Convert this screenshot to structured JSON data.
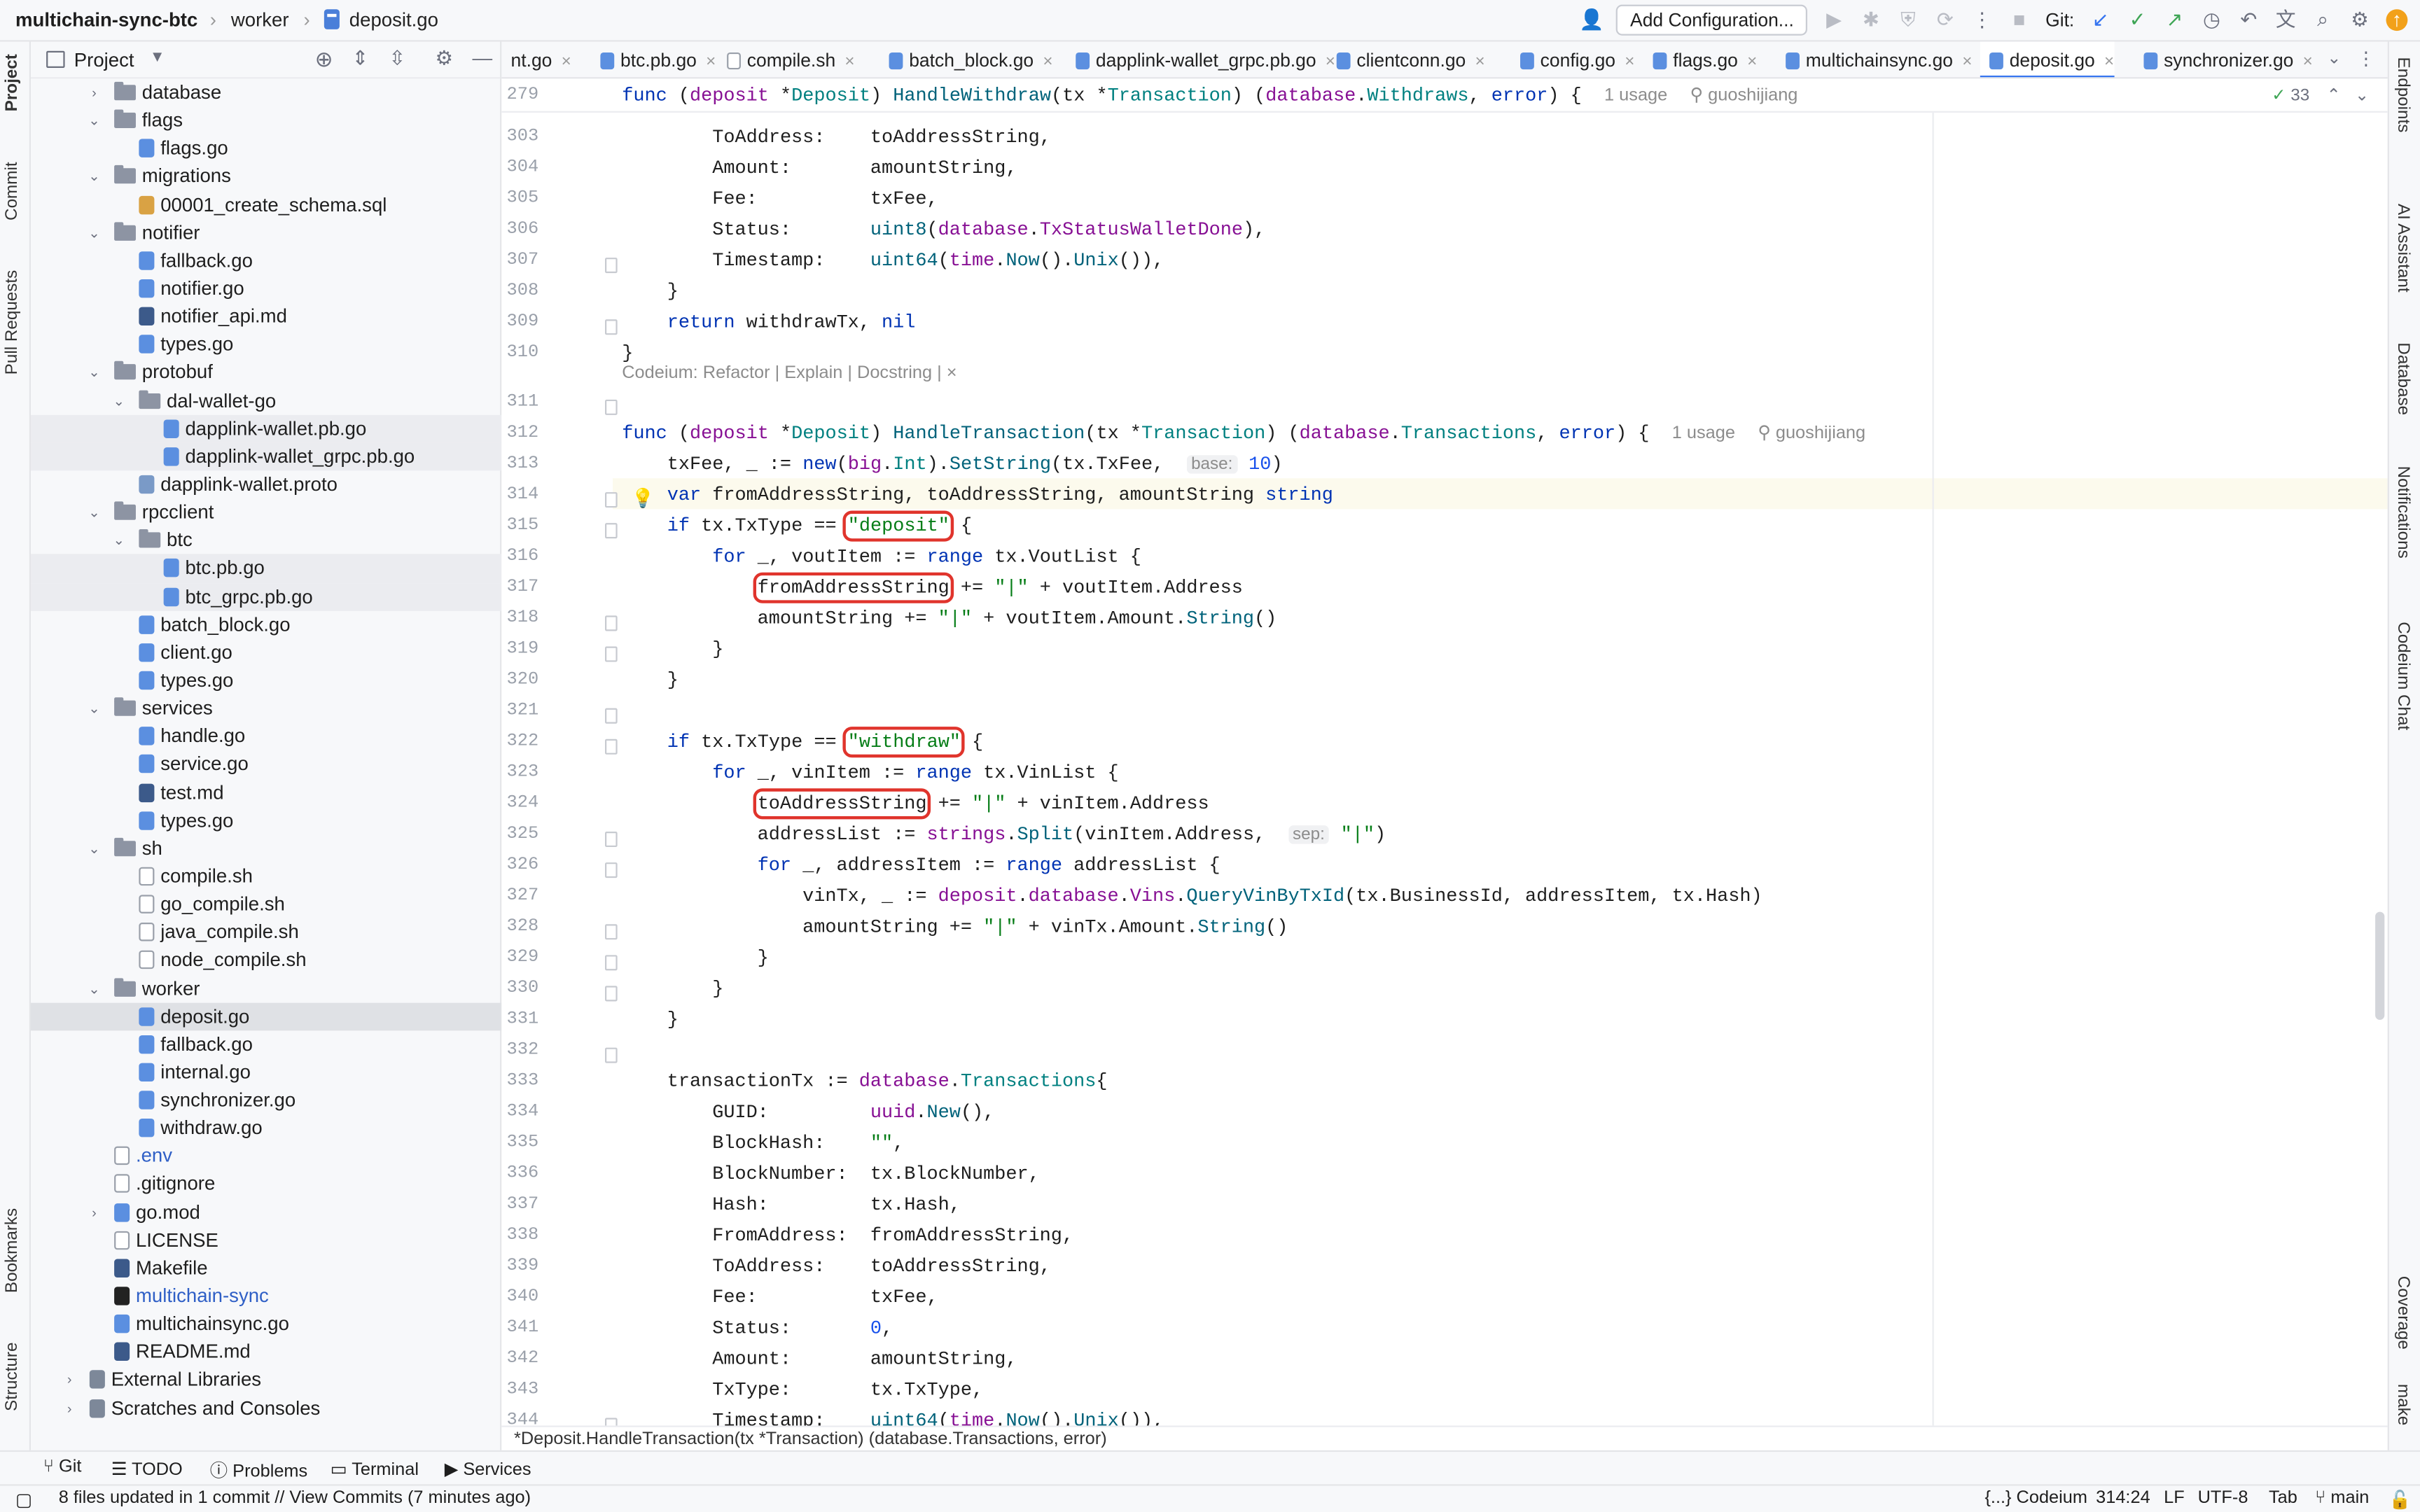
{
  "titlebar": {
    "project": "multichain-sync-btc",
    "breadcrumb": [
      "worker",
      "deposit.go"
    ],
    "add_configuration": "Add Configuration...",
    "git_label": "Git:"
  },
  "project_panel": {
    "title": "Project",
    "tree": [
      {
        "label": "database",
        "type": "folder",
        "depth": 1,
        "arrow": "right"
      },
      {
        "label": "flags",
        "type": "folder",
        "depth": 1,
        "arrow": "down"
      },
      {
        "label": "flags.go",
        "type": "go",
        "depth": 2
      },
      {
        "label": "migrations",
        "type": "folder",
        "depth": 1,
        "arrow": "down"
      },
      {
        "label": "00001_create_schema.sql",
        "type": "sql",
        "depth": 2
      },
      {
        "label": "notifier",
        "type": "folder",
        "depth": 1,
        "arrow": "down"
      },
      {
        "label": "fallback.go",
        "type": "go",
        "depth": 2
      },
      {
        "label": "notifier.go",
        "type": "go",
        "depth": 2
      },
      {
        "label": "notifier_api.md",
        "type": "md",
        "depth": 2
      },
      {
        "label": "types.go",
        "type": "go",
        "depth": 2
      },
      {
        "label": "protobuf",
        "type": "folder",
        "depth": 1,
        "arrow": "down"
      },
      {
        "label": "dal-wallet-go",
        "type": "folder",
        "depth": 2,
        "arrow": "down"
      },
      {
        "label": "dapplink-wallet.pb.go",
        "type": "go",
        "depth": 3,
        "hl": true
      },
      {
        "label": "dapplink-wallet_grpc.pb.go",
        "type": "go",
        "depth": 3,
        "hl": true
      },
      {
        "label": "dapplink-wallet.proto",
        "type": "pb",
        "depth": 2
      },
      {
        "label": "rpcclient",
        "type": "folder",
        "depth": 1,
        "arrow": "down"
      },
      {
        "label": "btc",
        "type": "folder",
        "depth": 2,
        "arrow": "down"
      },
      {
        "label": "btc.pb.go",
        "type": "go",
        "depth": 3,
        "hl": true
      },
      {
        "label": "btc_grpc.pb.go",
        "type": "go",
        "depth": 3,
        "hl": true
      },
      {
        "label": "batch_block.go",
        "type": "go",
        "depth": 2
      },
      {
        "label": "client.go",
        "type": "go",
        "depth": 2
      },
      {
        "label": "types.go",
        "type": "go",
        "depth": 2
      },
      {
        "label": "services",
        "type": "folder",
        "depth": 1,
        "arrow": "down"
      },
      {
        "label": "handle.go",
        "type": "go",
        "depth": 2
      },
      {
        "label": "service.go",
        "type": "go",
        "depth": 2
      },
      {
        "label": "test.md",
        "type": "md",
        "depth": 2
      },
      {
        "label": "types.go",
        "type": "go",
        "depth": 2
      },
      {
        "label": "sh",
        "type": "folder",
        "depth": 1,
        "arrow": "down"
      },
      {
        "label": "compile.sh",
        "type": "sh",
        "depth": 2
      },
      {
        "label": "go_compile.sh",
        "type": "sh",
        "depth": 2
      },
      {
        "label": "java_compile.sh",
        "type": "sh",
        "depth": 2
      },
      {
        "label": "node_compile.sh",
        "type": "sh",
        "depth": 2
      },
      {
        "label": "worker",
        "type": "folder",
        "depth": 1,
        "arrow": "down"
      },
      {
        "label": "deposit.go",
        "type": "go",
        "depth": 2,
        "sel": true
      },
      {
        "label": "fallback.go",
        "type": "go",
        "depth": 2
      },
      {
        "label": "internal.go",
        "type": "go",
        "depth": 2
      },
      {
        "label": "synchronizer.go",
        "type": "go",
        "depth": 2
      },
      {
        "label": "withdraw.go",
        "type": "go",
        "depth": 2
      },
      {
        "label": ".env",
        "type": "txt",
        "depth": 1,
        "blue": true
      },
      {
        "label": ".gitignore",
        "type": "txt",
        "depth": 1
      },
      {
        "label": "go.mod",
        "type": "go",
        "depth": 1,
        "arrow": "right"
      },
      {
        "label": "LICENSE",
        "type": "txt",
        "depth": 1
      },
      {
        "label": "Makefile",
        "type": "md",
        "depth": 1
      },
      {
        "label": "multichain-sync",
        "type": "bin",
        "depth": 1,
        "blue": true
      },
      {
        "label": "multichainsync.go",
        "type": "go",
        "depth": 1
      },
      {
        "label": "README.md",
        "type": "md",
        "depth": 1
      },
      {
        "label": "External Libraries",
        "type": "lib",
        "depth": 0,
        "arrow": "right"
      },
      {
        "label": "Scratches and Consoles",
        "type": "lib",
        "depth": 0,
        "arrow": "right"
      }
    ]
  },
  "tabs": [
    {
      "label": "nt.go",
      "type": "go"
    },
    {
      "label": "btc.pb.go",
      "type": "go"
    },
    {
      "label": "compile.sh",
      "type": "sh"
    },
    {
      "label": "batch_block.go",
      "type": "go"
    },
    {
      "label": "dapplink-wallet_grpc.pb.go",
      "type": "go"
    },
    {
      "label": "clientconn.go",
      "type": "go"
    },
    {
      "label": "config.go",
      "type": "go"
    },
    {
      "label": "flags.go",
      "type": "go"
    },
    {
      "label": "multichainsync.go",
      "type": "go"
    },
    {
      "label": "deposit.go",
      "type": "go",
      "active": true
    },
    {
      "label": "synchronizer.go",
      "type": "go"
    }
  ],
  "editor": {
    "sticky_line_number": "279",
    "sticky_usage": "1 usage",
    "sticky_author": "guoshijiang",
    "inspection_count": "33",
    "codeium_lens": "Codeium: Refactor | Explain | Docstring | ×",
    "usage_311": "1 usage",
    "author_311": "guoshijiang",
    "hint_base": "base:",
    "hint_sep": "sep:",
    "line_numbers": [
      "303",
      "304",
      "305",
      "306",
      "307",
      "308",
      "309",
      "310",
      "311",
      "312",
      "313",
      "314",
      "315",
      "316",
      "317",
      "318",
      "319",
      "320",
      "321",
      "322",
      "323",
      "324",
      "325",
      "326",
      "327",
      "328",
      "329",
      "330",
      "331",
      "332",
      "333",
      "334",
      "335",
      "336",
      "337",
      "338",
      "339",
      "340",
      "341",
      "342",
      "343",
      "344"
    ]
  },
  "editor_breadcrumb": "*Deposit.HandleTransaction(tx *Transaction) (database.Transactions, error)",
  "tool_windows": {
    "bottom": [
      "Git",
      "TODO",
      "Problems",
      "Terminal",
      "Services"
    ],
    "left": [
      "Project",
      "Commit",
      "Pull Requests",
      "Bookmarks",
      "Structure"
    ],
    "right": [
      "Endpoints",
      "AI Assistant",
      "Database",
      "Notifications",
      "Codeium Chat",
      "Coverage",
      "make"
    ]
  },
  "statusbar": {
    "message": "8 files updated in 1 commit // View Commits (7 minutes ago)",
    "codeium": "{...} Codeium",
    "position": "314:24",
    "line_sep": "LF",
    "encoding": "UTF-8",
    "indent": "Tab",
    "branch": "main"
  },
  "colors": {
    "accent": "#3574f0",
    "highlight_box": "#e0342c",
    "keyword": "#0033b3",
    "string": "#067d17"
  }
}
